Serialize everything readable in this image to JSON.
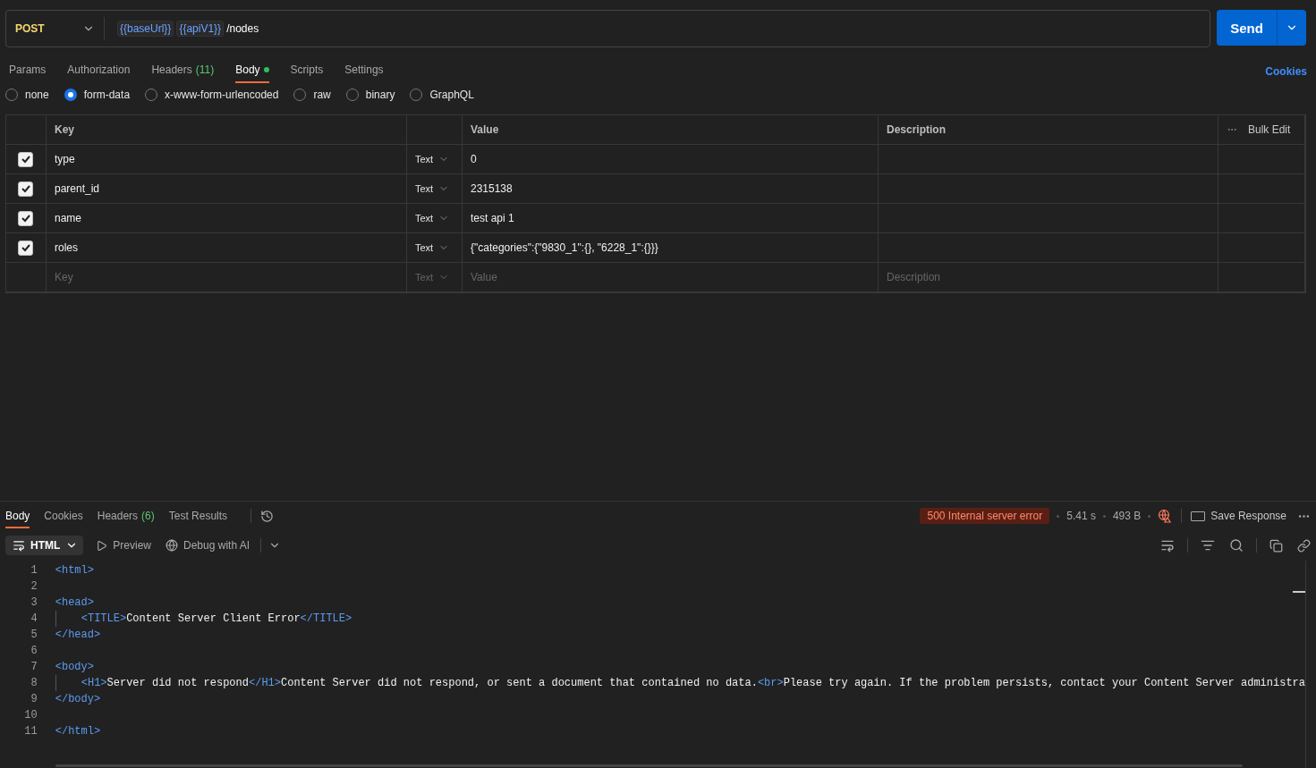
{
  "request": {
    "method": "POST",
    "url_parts": [
      {
        "kind": "variable",
        "text": "{{baseUrl}}"
      },
      {
        "kind": "variable",
        "text": "{{apiV1}}"
      },
      {
        "kind": "plain",
        "text": "/nodes"
      }
    ],
    "send": "Send"
  },
  "request_tabs": [
    {
      "label": "Params",
      "selected": false
    },
    {
      "label": "Authorization",
      "selected": false
    },
    {
      "label": "Headers",
      "count": "(11)",
      "selected": false
    },
    {
      "label": "Body",
      "dot": true,
      "selected": true
    },
    {
      "label": "Scripts",
      "selected": false
    },
    {
      "label": "Settings",
      "selected": false
    }
  ],
  "cookies_link": "Cookies",
  "body_types": [
    {
      "label": "none",
      "selected": false
    },
    {
      "label": "form-data",
      "selected": true
    },
    {
      "label": "x-www-form-urlencoded",
      "selected": false
    },
    {
      "label": "raw",
      "selected": false
    },
    {
      "label": "binary",
      "selected": false
    },
    {
      "label": "GraphQL",
      "selected": false
    }
  ],
  "form_table": {
    "columns": [
      "Key",
      "Value",
      "Description"
    ],
    "bulk_edit": "Bulk Edit",
    "rows": [
      {
        "checked": true,
        "key": "type",
        "type": "Text",
        "value": "0"
      },
      {
        "checked": true,
        "key": "parent_id",
        "type": "Text",
        "value": "2315138"
      },
      {
        "checked": true,
        "key": "name",
        "type": "Text",
        "value": "test api 1"
      },
      {
        "checked": true,
        "key": "roles",
        "type": "Text",
        "value": "{\"categories\":{\"9830_1\":{}, \"6228_1\":{}}}"
      }
    ],
    "new_row": {
      "key_placeholder": "Key",
      "type": "Text",
      "value_placeholder": "Value",
      "description_placeholder": "Description"
    }
  },
  "response_tabs": [
    {
      "label": "Body",
      "selected": true
    },
    {
      "label": "Cookies",
      "selected": false
    },
    {
      "label": "Headers",
      "count": "(6)",
      "selected": false
    },
    {
      "label": "Test Results",
      "selected": false
    }
  ],
  "status": {
    "code": "500 Internal server error",
    "time": "5.41 s",
    "size": "493 B",
    "save": "Save Response"
  },
  "format": {
    "label": "HTML",
    "preview": "Preview",
    "debug": "Debug with AI"
  },
  "code_lines": [
    {
      "num": "1",
      "tokens": [
        {
          "kind": "tag",
          "text": "<html>"
        }
      ]
    },
    {
      "num": "2"
    },
    {
      "num": "3",
      "tokens": [
        {
          "kind": "tag",
          "text": "<head>"
        }
      ]
    },
    {
      "num": "4",
      "indent": true,
      "tokens": [
        {
          "kind": "tag",
          "text": "<TITLE>"
        },
        {
          "kind": "text",
          "text": "Content Server Client Error"
        },
        {
          "kind": "tag",
          "text": "</TITLE>"
        }
      ]
    },
    {
      "num": "5",
      "tokens": [
        {
          "kind": "tag",
          "text": "</head>"
        }
      ]
    },
    {
      "num": "6"
    },
    {
      "num": "7",
      "tokens": [
        {
          "kind": "tag",
          "text": "<body>"
        }
      ]
    },
    {
      "num": "8",
      "indent": true,
      "tokens": [
        {
          "kind": "tag",
          "text": "<H1>"
        },
        {
          "kind": "text",
          "text": "Server did not respond"
        },
        {
          "kind": "tag",
          "text": "</H1>"
        },
        {
          "kind": "text",
          "text": "Content Server did not respond, or sent a document that contained no data."
        },
        {
          "kind": "tag",
          "text": "<br>"
        },
        {
          "kind": "text",
          "text": "Please try again. If the problem persists, contact your Content Server administra"
        }
      ]
    },
    {
      "num": "9",
      "tokens": [
        {
          "kind": "tag",
          "text": "</body>"
        }
      ]
    },
    {
      "num": "10"
    },
    {
      "num": "11",
      "tokens": [
        {
          "kind": "tag",
          "text": "</html>"
        }
      ]
    }
  ]
}
